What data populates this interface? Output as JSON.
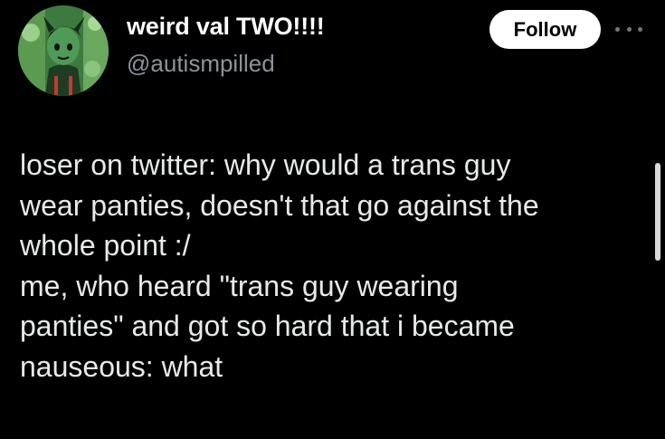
{
  "author": {
    "display_name": "weird val TWO!!!!",
    "handle": "@autismpilled",
    "avatar_icon": "character-avatar-icon"
  },
  "actions": {
    "follow_label": "Follow",
    "more_icon": "more-options-icon"
  },
  "tweet": {
    "lines": [
      "loser on twitter: why would a trans guy",
      "wear panties, doesn't that go against the",
      "whole point :/",
      "me, who heard \"trans guy wearing",
      "panties\" and got so hard that i became",
      "nauseous: what"
    ]
  },
  "colors": {
    "background": "#000000",
    "text": "#e7e9ea",
    "handle": "#8b949c",
    "follow_bg": "#ffffff",
    "avatar": "#2f6b34"
  }
}
